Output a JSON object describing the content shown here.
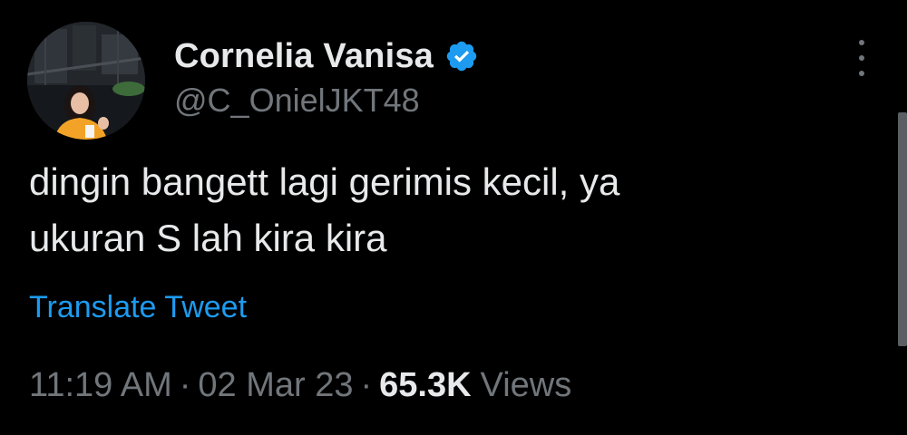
{
  "author": {
    "display_name": "Cornelia Vanisa",
    "handle": "@C_OnielJKT48",
    "verified": true
  },
  "tweet": {
    "text_lines": [
      "dingin bangett lagi gerimis kecil, ya",
      "ukuran S lah kira kira"
    ]
  },
  "translate_label": "Translate Tweet",
  "meta": {
    "time": "11:19 AM",
    "separator": "·",
    "date": "02 Mar 23",
    "views_count": "65.3K",
    "views_label": "Views"
  },
  "colors": {
    "background": "#000000",
    "primary_text": "#e7e9ea",
    "secondary_text": "#71767b",
    "link": "#1d9bf0",
    "verified_badge": "#1d9bf0"
  },
  "icons": {
    "verified": "verified-badge-icon",
    "more": "more-options-icon"
  }
}
